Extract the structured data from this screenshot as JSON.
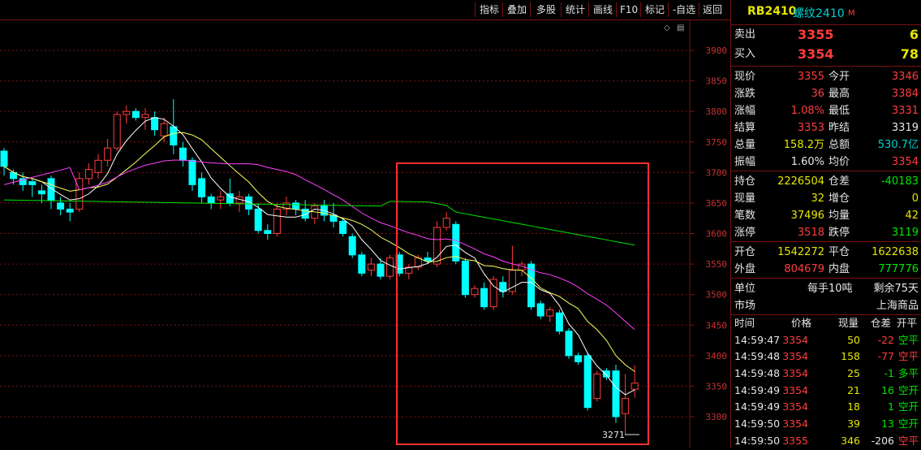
{
  "toolbar": {
    "buttons": [
      "指标",
      "叠加",
      "多股",
      "统计",
      "画线",
      "F10",
      "标记",
      "-自选",
      "返回"
    ]
  },
  "chart": {
    "y_labels": [
      "3900",
      "3850",
      "3800",
      "3750",
      "3700",
      "3650",
      "3600",
      "3550",
      "3500",
      "3450",
      "3400",
      "3350",
      "3300"
    ],
    "low_marker": "3271"
  },
  "colors": {
    "up": "#ff3c3c",
    "down": "#00ffff",
    "ma5": "#ffffff",
    "ma10": "#ffff60",
    "ma20": "#ff40ff",
    "ma60": "#00e600",
    "grid": "#7a1010"
  },
  "chart_data": {
    "type": "candlestick",
    "ylim": [
      3270,
      3920
    ],
    "candles": [
      [
        3735,
        3710,
        3740,
        3695
      ],
      [
        3700,
        3690,
        3705,
        3680
      ],
      [
        3690,
        3680,
        3700,
        3670
      ],
      [
        3685,
        3680,
        3690,
        3660
      ],
      [
        3670,
        3665,
        3680,
        3650
      ],
      [
        3690,
        3655,
        3695,
        3640
      ],
      [
        3650,
        3640,
        3660,
        3630
      ],
      [
        3640,
        3635,
        3650,
        3620
      ],
      [
        3640,
        3690,
        3700,
        3635
      ],
      [
        3690,
        3705,
        3715,
        3680
      ],
      [
        3700,
        3720,
        3730,
        3690
      ],
      [
        3720,
        3740,
        3755,
        3710
      ],
      [
        3740,
        3795,
        3800,
        3735
      ],
      [
        3795,
        3800,
        3810,
        3780
      ],
      [
        3800,
        3790,
        3805,
        3785
      ],
      [
        3790,
        3795,
        3805,
        3770
      ],
      [
        3790,
        3770,
        3800,
        3760
      ],
      [
        3760,
        3780,
        3790,
        3750
      ],
      [
        3775,
        3745,
        3820,
        3730
      ],
      [
        3740,
        3720,
        3750,
        3710
      ],
      [
        3720,
        3680,
        3725,
        3670
      ],
      [
        3690,
        3660,
        3700,
        3650
      ],
      [
        3660,
        3650,
        3665,
        3640
      ],
      [
        3655,
        3660,
        3670,
        3640
      ],
      [
        3665,
        3650,
        3690,
        3645
      ],
      [
        3650,
        3660,
        3670,
        3635
      ],
      [
        3660,
        3640,
        3665,
        3630
      ],
      [
        3640,
        3605,
        3650,
        3600
      ],
      [
        3605,
        3600,
        3615,
        3590
      ],
      [
        3600,
        3640,
        3650,
        3595
      ],
      [
        3640,
        3650,
        3660,
        3630
      ],
      [
        3650,
        3640,
        3655,
        3630
      ],
      [
        3640,
        3625,
        3655,
        3620
      ],
      [
        3625,
        3645,
        3650,
        3615
      ],
      [
        3645,
        3630,
        3655,
        3620
      ],
      [
        3630,
        3620,
        3650,
        3610
      ],
      [
        3620,
        3600,
        3625,
        3595
      ],
      [
        3595,
        3565,
        3600,
        3560
      ],
      [
        3565,
        3535,
        3570,
        3530
      ],
      [
        3540,
        3550,
        3560,
        3530
      ],
      [
        3550,
        3530,
        3560,
        3525
      ],
      [
        3530,
        3560,
        3565,
        3525
      ],
      [
        3565,
        3535,
        3570,
        3530
      ],
      [
        3535,
        3545,
        3550,
        3525
      ],
      [
        3545,
        3560,
        3565,
        3540
      ],
      [
        3560,
        3555,
        3570,
        3550
      ],
      [
        3550,
        3610,
        3620,
        3545
      ],
      [
        3610,
        3625,
        3635,
        3605
      ],
      [
        3615,
        3555,
        3620,
        3550
      ],
      [
        3555,
        3500,
        3560,
        3495
      ],
      [
        3500,
        3510,
        3515,
        3495
      ],
      [
        3510,
        3480,
        3520,
        3475
      ],
      [
        3480,
        3525,
        3530,
        3475
      ],
      [
        3520,
        3505,
        3530,
        3495
      ],
      [
        3505,
        3540,
        3580,
        3500
      ],
      [
        3540,
        3550,
        3555,
        3530
      ],
      [
        3550,
        3480,
        3555,
        3475
      ],
      [
        3485,
        3465,
        3490,
        3460
      ],
      [
        3465,
        3475,
        3480,
        3455
      ],
      [
        3470,
        3440,
        3475,
        3435
      ],
      [
        3440,
        3400,
        3445,
        3395
      ],
      [
        3400,
        3390,
        3405,
        3385
      ],
      [
        3400,
        3315,
        3405,
        3310
      ],
      [
        3330,
        3370,
        3375,
        3325
      ],
      [
        3375,
        3365,
        3380,
        3360
      ],
      [
        3375,
        3300,
        3385,
        3290
      ],
      [
        3305,
        3330,
        3370,
        3271
      ],
      [
        3345,
        3355,
        3384,
        3331
      ]
    ]
  },
  "panel": {
    "title_code": "RB2410",
    "title_name": "螺纹2410",
    "title_flag": "M",
    "sell_label": "卖出",
    "sell_price": "3355",
    "sell_vol": "6",
    "buy_label": "买入",
    "buy_price": "3354",
    "buy_vol": "78",
    "quote_rows": [
      {
        "l1": "现价",
        "v1": "3355",
        "c1": "red",
        "l2": "今开",
        "v2": "3346",
        "c2": "red"
      },
      {
        "l1": "涨跌",
        "v1": "36",
        "c1": "red",
        "l2": "最高",
        "v2": "3384",
        "c2": "red"
      },
      {
        "l1": "涨幅",
        "v1": "1.08%",
        "c1": "red",
        "l2": "最低",
        "v2": "3331",
        "c2": "red"
      },
      {
        "l1": "结算",
        "v1": "3353",
        "c1": "red",
        "l2": "昨结",
        "v2": "3319",
        "c2": "white"
      },
      {
        "l1": "总量",
        "v1": "158.2万",
        "c1": "yellow",
        "l2": "总额",
        "v2": "530.7亿",
        "c2": "cyan"
      },
      {
        "l1": "振幅",
        "v1": "1.60%",
        "c1": "white",
        "l2": "均价",
        "v2": "3354",
        "c2": "red"
      }
    ],
    "oi_rows": [
      {
        "l1": "持仓",
        "v1": "2226504",
        "c1": "yellow",
        "l2": "仓差",
        "v2": "-40183",
        "c2": "green"
      },
      {
        "l1": "现量",
        "v1": "32",
        "c1": "yellow",
        "l2": "增仓",
        "v2": "0",
        "c2": "yellow"
      },
      {
        "l1": "笔数",
        "v1": "37496",
        "c1": "yellow",
        "l2": "均量",
        "v2": "42",
        "c2": "yellow"
      },
      {
        "l1": "涨停",
        "v1": "3518",
        "c1": "red",
        "l2": "跌停",
        "v2": "3119",
        "c2": "green"
      }
    ],
    "flow_rows": [
      {
        "l1": "开仓",
        "v1": "1542272",
        "c1": "yellow",
        "l2": "平仓",
        "v2": "1622638",
        "c2": "yellow"
      },
      {
        "l1": "外盘",
        "v1": "804679",
        "c1": "red",
        "l2": "内盘",
        "v2": "777776",
        "c2": "green"
      }
    ],
    "unit_label": "单位",
    "unit_value": "每手10吨",
    "remain_value": "剩余75天",
    "market_label": "市场",
    "market_value": "上海商品",
    "trade_headers": [
      "时间",
      "价格",
      "现量",
      "仓差",
      "开平"
    ],
    "trades": [
      {
        "time": "14:59:47",
        "price": "3354",
        "vol": "50",
        "diff": "-22",
        "type": "空平",
        "tc": "green",
        "dc": "red"
      },
      {
        "time": "14:59:48",
        "price": "3354",
        "vol": "158",
        "diff": "-77",
        "type": "空平",
        "tc": "red",
        "dc": "red"
      },
      {
        "time": "14:59:48",
        "price": "3354",
        "vol": "25",
        "diff": "-1",
        "type": "多平",
        "tc": "green",
        "dc": "green"
      },
      {
        "time": "14:59:49",
        "price": "3354",
        "vol": "21",
        "diff": "16",
        "type": "空开",
        "tc": "green",
        "dc": "green"
      },
      {
        "time": "14:59:49",
        "price": "3354",
        "vol": "18",
        "diff": "1",
        "type": "空开",
        "tc": "green",
        "dc": "green"
      },
      {
        "time": "14:59:50",
        "price": "3354",
        "vol": "39",
        "diff": "13",
        "type": "空开",
        "tc": "green",
        "dc": "green"
      },
      {
        "time": "14:59:50",
        "price": "3355",
        "vol": "346",
        "diff": "-206",
        "type": "空平",
        "tc": "red",
        "dc": "white"
      }
    ]
  }
}
